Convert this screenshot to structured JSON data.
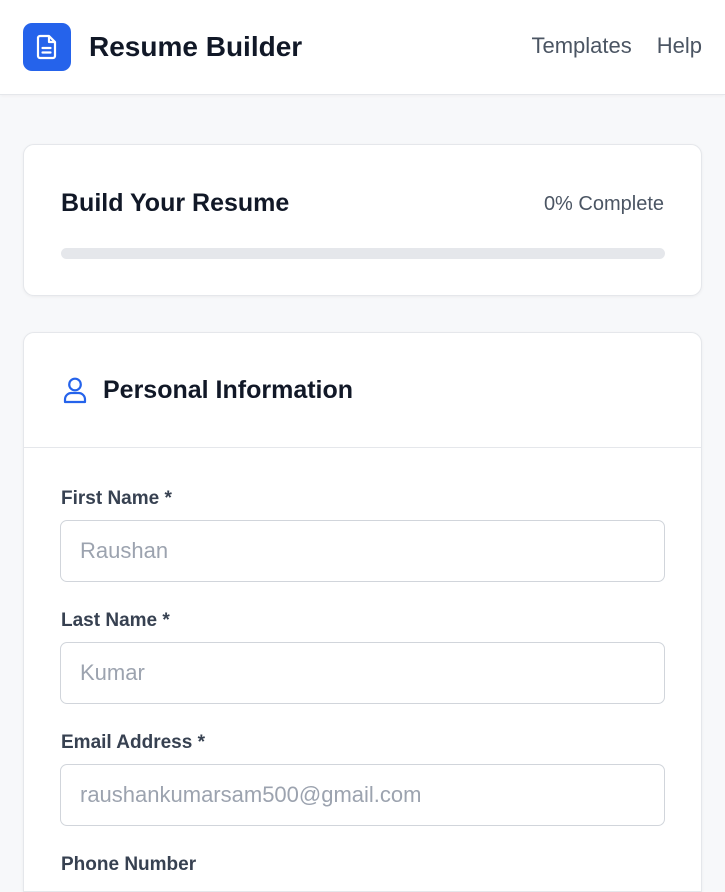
{
  "header": {
    "app_title": "Resume Builder",
    "logo_icon": "document-icon",
    "nav": [
      {
        "label": "Templates"
      },
      {
        "label": "Help"
      }
    ]
  },
  "progress": {
    "title": "Build Your Resume",
    "status": "0% Complete",
    "percent": 0
  },
  "personal_info": {
    "title": "Personal Information",
    "icon": "user-icon",
    "fields": {
      "first_name": {
        "label": "First Name *",
        "placeholder": "Raushan"
      },
      "last_name": {
        "label": "Last Name *",
        "placeholder": "Kumar"
      },
      "email": {
        "label": "Email Address *",
        "placeholder": "raushankumarsam500@gmail.com"
      },
      "phone": {
        "label": "Phone Number"
      }
    }
  },
  "colors": {
    "accent": "#2563eb",
    "background": "#f7f8fa",
    "track": "#e5e7eb"
  }
}
